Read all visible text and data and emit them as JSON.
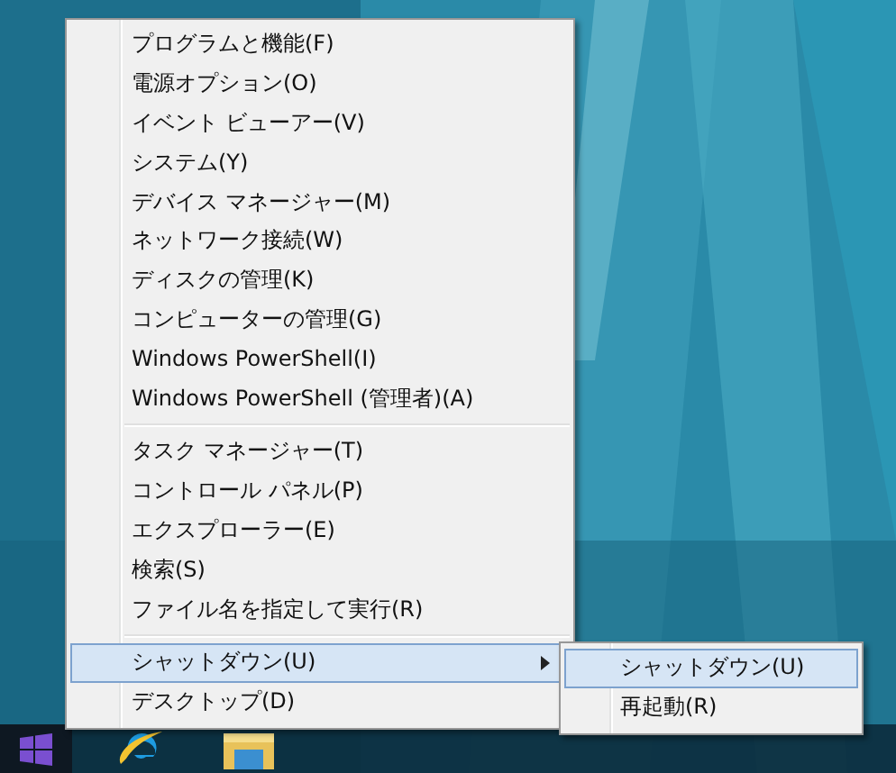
{
  "menu": {
    "sections": [
      {
        "items": [
          {
            "label": "プログラムと機能(F)",
            "selected": false,
            "has_submenu": false
          },
          {
            "label": "電源オプション(O)",
            "selected": false,
            "has_submenu": false
          },
          {
            "label": "イベント ビューアー(V)",
            "selected": false,
            "has_submenu": false
          },
          {
            "label": "システム(Y)",
            "selected": false,
            "has_submenu": false
          },
          {
            "label": "デバイス マネージャー(M)",
            "selected": false,
            "has_submenu": false
          },
          {
            "label": "ネットワーク接続(W)",
            "selected": false,
            "has_submenu": false
          },
          {
            "label": "ディスクの管理(K)",
            "selected": false,
            "has_submenu": false
          },
          {
            "label": "コンピューターの管理(G)",
            "selected": false,
            "has_submenu": false
          },
          {
            "label": "Windows PowerShell(I)",
            "selected": false,
            "has_submenu": false
          },
          {
            "label": "Windows PowerShell (管理者)(A)",
            "selected": false,
            "has_submenu": false
          }
        ]
      },
      {
        "items": [
          {
            "label": "タスク マネージャー(T)",
            "selected": false,
            "has_submenu": false
          },
          {
            "label": "コントロール パネル(P)",
            "selected": false,
            "has_submenu": false
          },
          {
            "label": "エクスプローラー(E)",
            "selected": false,
            "has_submenu": false
          },
          {
            "label": "検索(S)",
            "selected": false,
            "has_submenu": false
          },
          {
            "label": "ファイル名を指定して実行(R)",
            "selected": false,
            "has_submenu": false
          }
        ]
      },
      {
        "items": [
          {
            "label": "シャットダウン(U)",
            "selected": true,
            "has_submenu": true
          },
          {
            "label": "デスクトップ(D)",
            "selected": false,
            "has_submenu": false
          }
        ]
      }
    ]
  },
  "submenu": {
    "items": [
      {
        "label": "シャットダウン(U)",
        "selected": true
      },
      {
        "label": "再起動(R)",
        "selected": false
      }
    ]
  },
  "taskbar": {
    "start_button": {
      "selected": true
    }
  }
}
